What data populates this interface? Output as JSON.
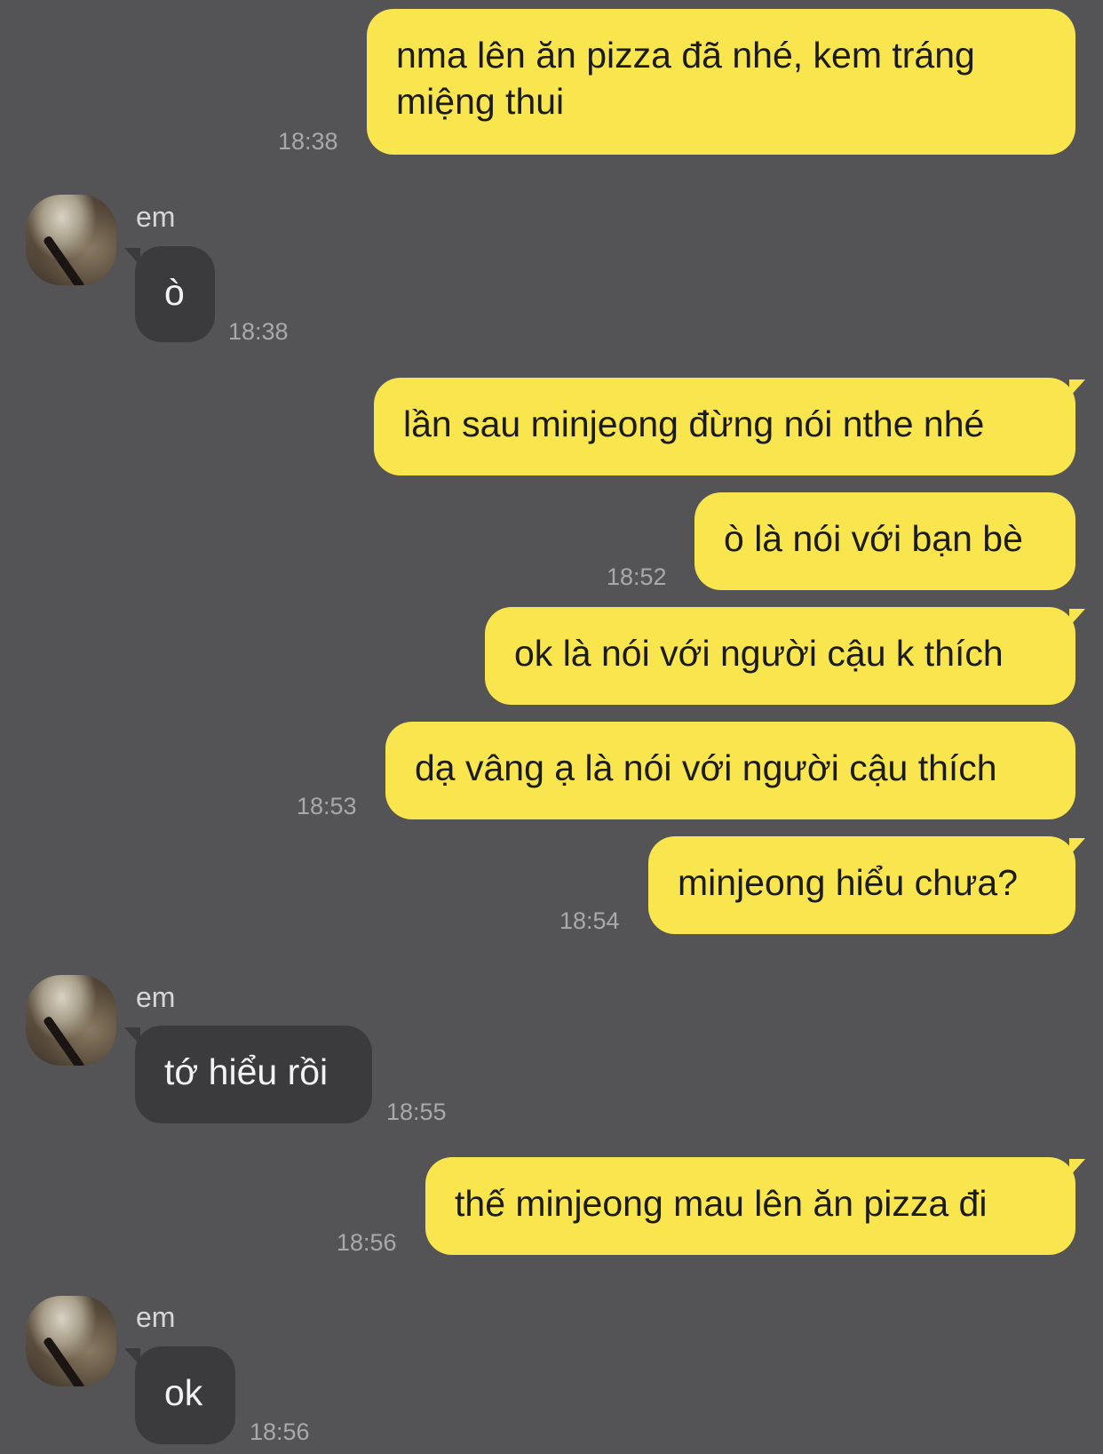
{
  "contact": {
    "name": "em"
  },
  "messages": [
    {
      "direction": "out",
      "text": "nma lên ăn pizza đã nhé, kem tráng miệng thui",
      "time": "18:38"
    },
    {
      "direction": "in",
      "text": "ò",
      "time": "18:38"
    },
    {
      "direction": "out",
      "text": "lần sau minjeong đừng nói nthe nhé",
      "time": ""
    },
    {
      "direction": "out",
      "text": "ò là nói với bạn bè",
      "time": "18:52"
    },
    {
      "direction": "out",
      "text": "ok là nói với người cậu k thích",
      "time": ""
    },
    {
      "direction": "out",
      "text": "dạ vâng ạ là nói với người cậu thích",
      "time": "18:53"
    },
    {
      "direction": "out",
      "text": "minjeong hiểu chưa?",
      "time": "18:54"
    },
    {
      "direction": "in",
      "text": "tớ hiểu rồi",
      "time": "18:55"
    },
    {
      "direction": "out",
      "text": "thế minjeong mau lên ăn pizza đi",
      "time": "18:56"
    },
    {
      "direction": "in",
      "text": "ok",
      "time": "18:56"
    }
  ],
  "colors": {
    "background": "#545355",
    "outgoing_bubble": "#f9e54e",
    "incoming_bubble": "#3b3a3c",
    "timestamp": "#a9a8aa"
  }
}
